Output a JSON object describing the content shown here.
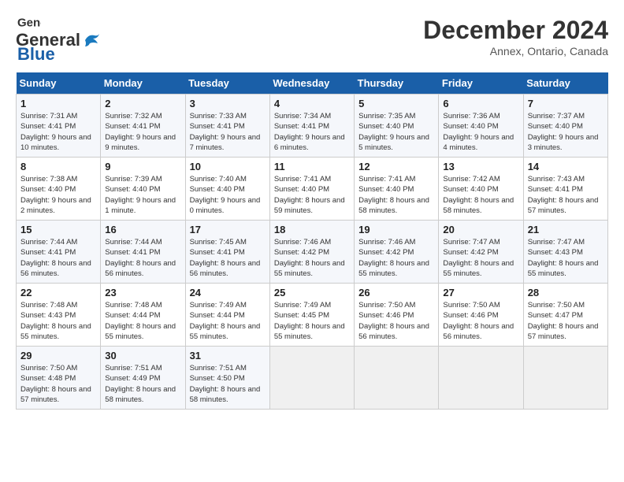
{
  "logo": {
    "text_general": "General",
    "text_blue": "Blue"
  },
  "title": "December 2024",
  "location": "Annex, Ontario, Canada",
  "days_of_week": [
    "Sunday",
    "Monday",
    "Tuesday",
    "Wednesday",
    "Thursday",
    "Friday",
    "Saturday"
  ],
  "weeks": [
    [
      {
        "day": "1",
        "sunrise": "Sunrise: 7:31 AM",
        "sunset": "Sunset: 4:41 PM",
        "daylight": "Daylight: 9 hours and 10 minutes."
      },
      {
        "day": "2",
        "sunrise": "Sunrise: 7:32 AM",
        "sunset": "Sunset: 4:41 PM",
        "daylight": "Daylight: 9 hours and 9 minutes."
      },
      {
        "day": "3",
        "sunrise": "Sunrise: 7:33 AM",
        "sunset": "Sunset: 4:41 PM",
        "daylight": "Daylight: 9 hours and 7 minutes."
      },
      {
        "day": "4",
        "sunrise": "Sunrise: 7:34 AM",
        "sunset": "Sunset: 4:41 PM",
        "daylight": "Daylight: 9 hours and 6 minutes."
      },
      {
        "day": "5",
        "sunrise": "Sunrise: 7:35 AM",
        "sunset": "Sunset: 4:40 PM",
        "daylight": "Daylight: 9 hours and 5 minutes."
      },
      {
        "day": "6",
        "sunrise": "Sunrise: 7:36 AM",
        "sunset": "Sunset: 4:40 PM",
        "daylight": "Daylight: 9 hours and 4 minutes."
      },
      {
        "day": "7",
        "sunrise": "Sunrise: 7:37 AM",
        "sunset": "Sunset: 4:40 PM",
        "daylight": "Daylight: 9 hours and 3 minutes."
      }
    ],
    [
      {
        "day": "8",
        "sunrise": "Sunrise: 7:38 AM",
        "sunset": "Sunset: 4:40 PM",
        "daylight": "Daylight: 9 hours and 2 minutes."
      },
      {
        "day": "9",
        "sunrise": "Sunrise: 7:39 AM",
        "sunset": "Sunset: 4:40 PM",
        "daylight": "Daylight: 9 hours and 1 minute."
      },
      {
        "day": "10",
        "sunrise": "Sunrise: 7:40 AM",
        "sunset": "Sunset: 4:40 PM",
        "daylight": "Daylight: 9 hours and 0 minutes."
      },
      {
        "day": "11",
        "sunrise": "Sunrise: 7:41 AM",
        "sunset": "Sunset: 4:40 PM",
        "daylight": "Daylight: 8 hours and 59 minutes."
      },
      {
        "day": "12",
        "sunrise": "Sunrise: 7:41 AM",
        "sunset": "Sunset: 4:40 PM",
        "daylight": "Daylight: 8 hours and 58 minutes."
      },
      {
        "day": "13",
        "sunrise": "Sunrise: 7:42 AM",
        "sunset": "Sunset: 4:40 PM",
        "daylight": "Daylight: 8 hours and 58 minutes."
      },
      {
        "day": "14",
        "sunrise": "Sunrise: 7:43 AM",
        "sunset": "Sunset: 4:41 PM",
        "daylight": "Daylight: 8 hours and 57 minutes."
      }
    ],
    [
      {
        "day": "15",
        "sunrise": "Sunrise: 7:44 AM",
        "sunset": "Sunset: 4:41 PM",
        "daylight": "Daylight: 8 hours and 56 minutes."
      },
      {
        "day": "16",
        "sunrise": "Sunrise: 7:44 AM",
        "sunset": "Sunset: 4:41 PM",
        "daylight": "Daylight: 8 hours and 56 minutes."
      },
      {
        "day": "17",
        "sunrise": "Sunrise: 7:45 AM",
        "sunset": "Sunset: 4:41 PM",
        "daylight": "Daylight: 8 hours and 56 minutes."
      },
      {
        "day": "18",
        "sunrise": "Sunrise: 7:46 AM",
        "sunset": "Sunset: 4:42 PM",
        "daylight": "Daylight: 8 hours and 55 minutes."
      },
      {
        "day": "19",
        "sunrise": "Sunrise: 7:46 AM",
        "sunset": "Sunset: 4:42 PM",
        "daylight": "Daylight: 8 hours and 55 minutes."
      },
      {
        "day": "20",
        "sunrise": "Sunrise: 7:47 AM",
        "sunset": "Sunset: 4:42 PM",
        "daylight": "Daylight: 8 hours and 55 minutes."
      },
      {
        "day": "21",
        "sunrise": "Sunrise: 7:47 AM",
        "sunset": "Sunset: 4:43 PM",
        "daylight": "Daylight: 8 hours and 55 minutes."
      }
    ],
    [
      {
        "day": "22",
        "sunrise": "Sunrise: 7:48 AM",
        "sunset": "Sunset: 4:43 PM",
        "daylight": "Daylight: 8 hours and 55 minutes."
      },
      {
        "day": "23",
        "sunrise": "Sunrise: 7:48 AM",
        "sunset": "Sunset: 4:44 PM",
        "daylight": "Daylight: 8 hours and 55 minutes."
      },
      {
        "day": "24",
        "sunrise": "Sunrise: 7:49 AM",
        "sunset": "Sunset: 4:44 PM",
        "daylight": "Daylight: 8 hours and 55 minutes."
      },
      {
        "day": "25",
        "sunrise": "Sunrise: 7:49 AM",
        "sunset": "Sunset: 4:45 PM",
        "daylight": "Daylight: 8 hours and 55 minutes."
      },
      {
        "day": "26",
        "sunrise": "Sunrise: 7:50 AM",
        "sunset": "Sunset: 4:46 PM",
        "daylight": "Daylight: 8 hours and 56 minutes."
      },
      {
        "day": "27",
        "sunrise": "Sunrise: 7:50 AM",
        "sunset": "Sunset: 4:46 PM",
        "daylight": "Daylight: 8 hours and 56 minutes."
      },
      {
        "day": "28",
        "sunrise": "Sunrise: 7:50 AM",
        "sunset": "Sunset: 4:47 PM",
        "daylight": "Daylight: 8 hours and 57 minutes."
      }
    ],
    [
      {
        "day": "29",
        "sunrise": "Sunrise: 7:50 AM",
        "sunset": "Sunset: 4:48 PM",
        "daylight": "Daylight: 8 hours and 57 minutes."
      },
      {
        "day": "30",
        "sunrise": "Sunrise: 7:51 AM",
        "sunset": "Sunset: 4:49 PM",
        "daylight": "Daylight: 8 hours and 58 minutes."
      },
      {
        "day": "31",
        "sunrise": "Sunrise: 7:51 AM",
        "sunset": "Sunset: 4:50 PM",
        "daylight": "Daylight: 8 hours and 58 minutes."
      },
      null,
      null,
      null,
      null
    ]
  ]
}
